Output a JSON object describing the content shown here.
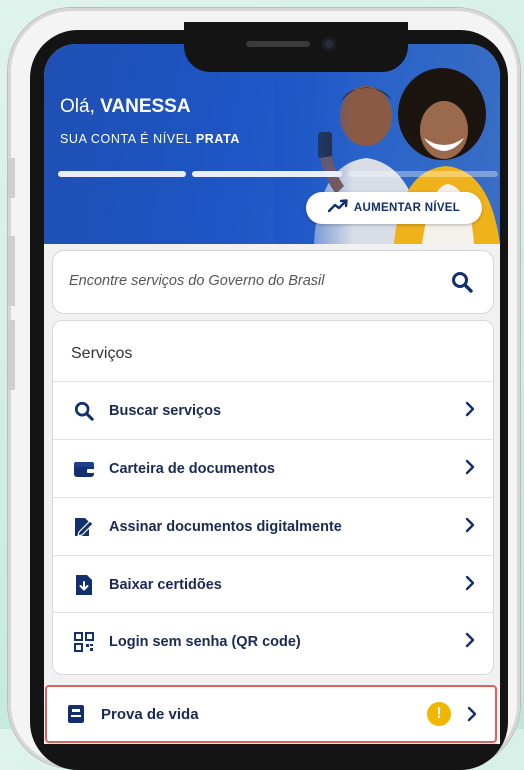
{
  "hero": {
    "greeting_prefix": "Olá, ",
    "user_name": "VANESSA",
    "level_prefix": "SUA CONTA É NÍVEL ",
    "level_name": "PRATA",
    "upgrade_label": "AUMENTAR NÍVEL"
  },
  "search": {
    "placeholder": "Encontre serviços do Governo do Brasil",
    "icon": "search-icon"
  },
  "services": {
    "title": "Serviços",
    "items": [
      {
        "label": "Buscar serviços",
        "icon": "search-icon"
      },
      {
        "label": "Carteira de documentos",
        "icon": "wallet-icon"
      },
      {
        "label": "Assinar documentos digitalmente",
        "icon": "sign-document-icon"
      },
      {
        "label": "Baixar certidões",
        "icon": "download-certificate-icon"
      },
      {
        "label": "Login sem senha (QR code)",
        "icon": "qr-code-icon"
      }
    ]
  },
  "proof_of_life": {
    "label": "Prova de vida",
    "icon": "id-card-icon",
    "alert_symbol": "!"
  },
  "colors": {
    "brand_blue": "#1f4fb3",
    "navy_text": "#1b2a52",
    "icon_navy": "#12306e",
    "warning": "#f1b600",
    "alert_border": "#e0615c"
  }
}
